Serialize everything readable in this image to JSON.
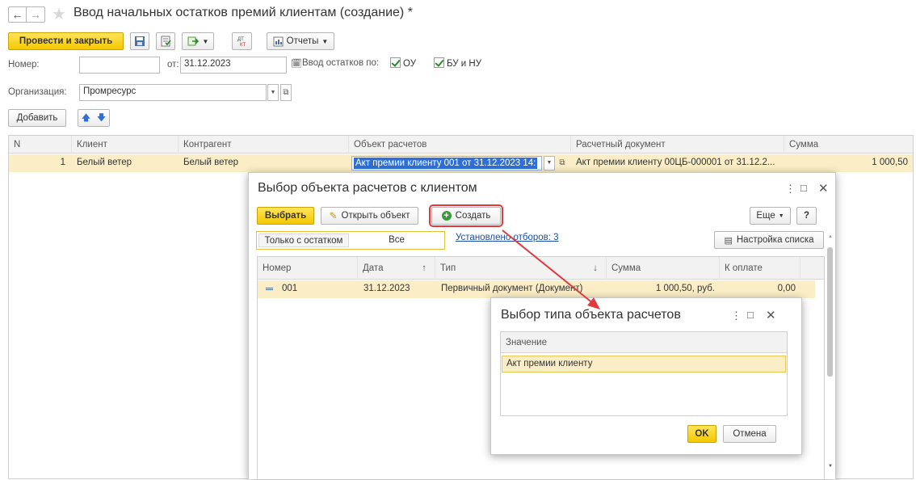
{
  "window": {
    "title": "Ввод начальных остатков премий клиентам (создание) *"
  },
  "toolbar": {
    "post_close_label": "Провести и закрыть",
    "reports_label": "Отчеты"
  },
  "form": {
    "number_label": "Номер:",
    "number_value": "",
    "date_label": "от:",
    "date_value": "31.12.2023",
    "balance_input_label": "Ввод остатков по:",
    "ou_label": "ОУ",
    "bu_nu_label": "БУ и НУ",
    "org_label": "Организация:",
    "org_value": "Промресурс",
    "add_label": "Добавить"
  },
  "table": {
    "headers": [
      "N",
      "Клиент",
      "Контрагент",
      "Объект расчетов",
      "Расчетный документ",
      "Сумма"
    ],
    "rows": [
      {
        "n": "1",
        "client": "Белый ветер",
        "counterparty": "Белый ветер",
        "object": "Акт премии клиенту 001 от 31.12.2023 14:",
        "document": "Акт премии клиенту 00ЦБ-000001 от 31.12.2...",
        "sum": "1 000,50"
      }
    ]
  },
  "dialog1": {
    "title": "Выбор объекта расчетов с клиентом",
    "select_label": "Выбрать",
    "open_label": "Открыть объект",
    "create_label": "Создать",
    "more_label": "Еще",
    "help_label": "?",
    "only_balance_label": "Только с остатком",
    "all_label": "Все",
    "filters_link": "Установлено отборов: 3",
    "list_settings_label": "Настройка списка",
    "headers": [
      "Номер",
      "Дата",
      "Тип",
      "Сумма",
      "К оплате"
    ],
    "rows": [
      {
        "number": "001",
        "date": "31.12.2023",
        "type": "Первичный документ (Документ)",
        "sum": "1 000,50, руб.",
        "to_pay": "0,00"
      }
    ]
  },
  "dialog2": {
    "title": "Выбор типа объекта расчетов",
    "header": "Значение",
    "items": [
      "Акт премии клиенту"
    ],
    "ok_label": "OK",
    "cancel_label": "Отмена"
  },
  "colors": {
    "accent_yellow": "#f4c800",
    "row_highlight": "#fbeec6",
    "selection_blue": "#2f6fd6",
    "callout_red": "#e0393e",
    "link_blue": "#1a4fa6"
  }
}
